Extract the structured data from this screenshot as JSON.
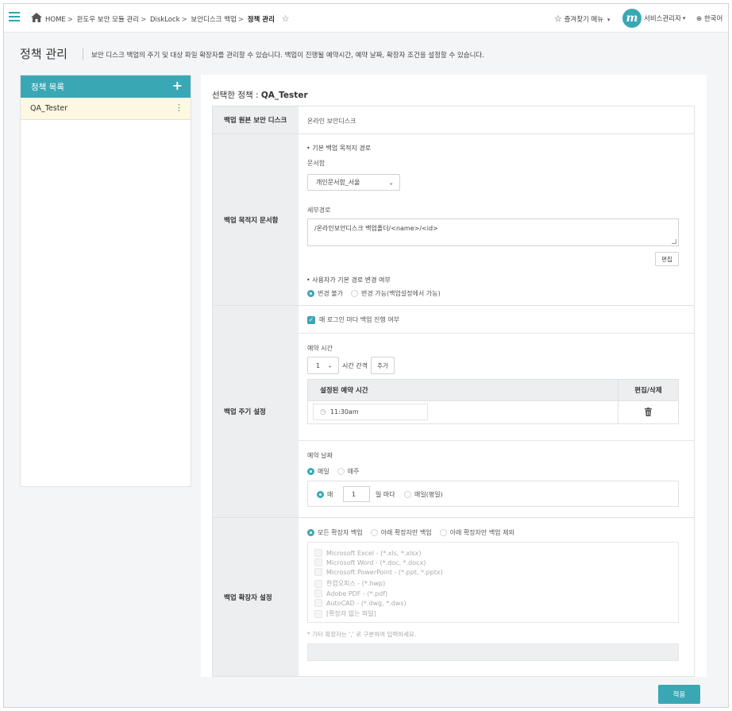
{
  "header": {
    "breadcrumb": [
      {
        "label": "HOME"
      },
      {
        "label": "윈도우 보안 모듈 관리"
      },
      {
        "label": "DiskLock"
      },
      {
        "label": "보안디스크 백업"
      },
      {
        "label": "정책 관리",
        "current": true
      }
    ],
    "favorites_label": "즐겨찾기 메뉴",
    "user_name": "서비스관리자",
    "avatar_letter": "m",
    "language": "한국어"
  },
  "page": {
    "title": "정책 관리",
    "description": "보안 디스크 백업의 주기 및 대상 파일 확장자를 관리할 수 있습니다. 백업이 진행될 예약시간, 예약 날짜, 확장자 조건을 설정할 수 있습니다."
  },
  "policy_list": {
    "title": "정책 목록",
    "items": [
      {
        "name": "QA_Tester"
      }
    ]
  },
  "detail": {
    "selected_prefix": "선택한 정책 : ",
    "selected_name": "QA_Tester",
    "source": {
      "label": "백업 원본 보안 디스크",
      "value": "온라인 보안디스크"
    },
    "destination": {
      "label": "백업 목적지 문서함",
      "default_path_title": "• 기본 백업 목적지 경로",
      "cabinet_label": "문서함",
      "cabinet_value": "개인문서함_서울",
      "subpath_label": "세부경로",
      "subpath_value": "/온라인보안디스크 백업폴더/<name>/<id>",
      "edit_button": "편집",
      "user_change_title": "• 사용자가 기본 경로 변경 여부",
      "options": [
        {
          "label": "변경 불가",
          "selected": true
        },
        {
          "label": "변경 가능(백업설정에서 가능)",
          "selected": false
        }
      ]
    },
    "schedule": {
      "label": "백업 주기 설정",
      "login_backup_label": "매 로그인 마다 백업 진행 여부",
      "login_backup_checked": true,
      "time_title": "예약 시간",
      "interval_value": "1",
      "interval_suffix": "시간 간격",
      "add_button": "추가",
      "table_headers": {
        "time": "설정된 예약 시간",
        "action": "편집/삭제"
      },
      "times": [
        "11:30am"
      ],
      "date_title": "예약 날짜",
      "date_options": [
        {
          "label": "매일",
          "selected": true
        },
        {
          "label": "매주",
          "selected": false
        }
      ],
      "every_label": "매",
      "every_value": "1",
      "every_suffix": "일 마다",
      "weekday_label": "매일(평일)"
    },
    "extensions": {
      "label": "백업 확장자 설정",
      "mode_options": [
        {
          "label": "모든 확장자 백업",
          "selected": true
        },
        {
          "label": "아래 확장자만 백업",
          "selected": false
        },
        {
          "label": "아래 확장자만 백업 제외",
          "selected": false
        }
      ],
      "items": [
        "Microsoft Excel - (*.xls, *.xlsx)",
        "Microsoft Word - (*.doc, *.docx)",
        "Microsoft PowerPoint - (*.ppt, *.pptx)",
        "한컴오피스 - (*.hwp)",
        "Adobe PDF - (*.pdf)",
        "AutoCAD - (*.dwg, *.dws)",
        "[확장자 없는 파일]"
      ],
      "note": "* 기타 확장자는 ',' 로 구분하여 입력하세요."
    },
    "apply_button": "적용"
  },
  "colors": {
    "accent": "#3aa8b4",
    "selected_row": "#fdf8e2",
    "label_bg": "#eceef0"
  }
}
